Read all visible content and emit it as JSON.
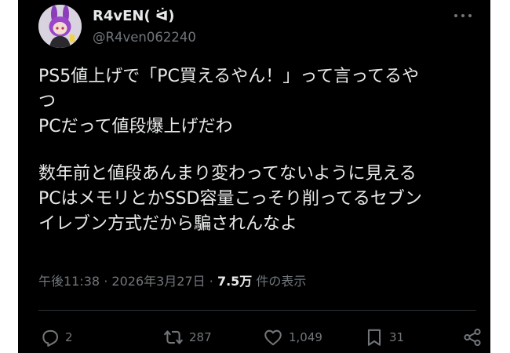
{
  "author": {
    "display_name": "R4vEN( ᐛ)",
    "handle": "@R4ven062240"
  },
  "tweet": {
    "lines": [
      "PS5値上げで「PC買えるやん！」って言ってるや",
      "つ",
      "PCだって値段爆上げだわ",
      "",
      "数年前と値段あんまり変わってないように見える",
      "PCはメモリとかSSD容量こっそり削ってるセブン",
      "イレブン方式だから騙されんなよ"
    ]
  },
  "meta": {
    "time": "午後11:38",
    "separator": "·",
    "date": "2026年3月27日",
    "views_count": "7.5万",
    "views_label": "件の表示"
  },
  "actions": {
    "replies": "2",
    "reposts": "287",
    "likes": "1,049",
    "bookmarks": "31"
  },
  "icons": {
    "more": "more-horizontal-icon",
    "reply": "reply-icon",
    "repost": "repost-icon",
    "like": "heart-icon",
    "bookmark": "bookmark-icon",
    "share": "share-icon"
  },
  "colors": {
    "background": "#000000",
    "text": "#e7e9ea",
    "secondary": "#71767b"
  }
}
